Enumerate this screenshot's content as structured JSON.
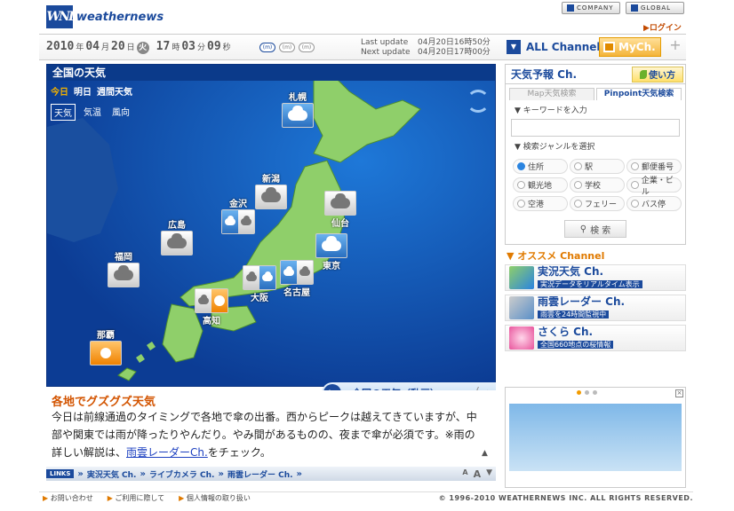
{
  "header": {
    "logo_mark": "WNI",
    "logo_text": "weathernews",
    "company": "COMPANY",
    "global": "GLOBAL",
    "login": "ログイン"
  },
  "datebar": {
    "year": "2010",
    "year_unit": "年",
    "month": "04",
    "month_unit": "月",
    "day": "20",
    "day_unit": "日",
    "dow": "火",
    "hour": "17",
    "hour_unit": "時",
    "minute": "03",
    "minute_unit": "分",
    "second": "09",
    "second_unit": "秒",
    "size_small": "(m)",
    "size_medium": "(m)",
    "size_large": "(m)",
    "last_update_label": "Last update",
    "last_update_value": "04月20日16時50分",
    "next_update_label": "Next update",
    "next_update_value": "04月20日17時00分",
    "all_channel": "ALL Channel",
    "mych": "MyCh.",
    "plus": "+"
  },
  "map": {
    "title": "全国の天気",
    "day_tabs": [
      "今日",
      "明日",
      "週間天気"
    ],
    "type_tabs": [
      "天気",
      "気温",
      "風向"
    ],
    "cities": [
      {
        "name": "札幌",
        "kind": "blue"
      },
      {
        "name": "新潟",
        "kind": "cloud"
      },
      {
        "name": "仙台",
        "kind": "cloud"
      },
      {
        "name": "金沢",
        "kind": "dual-bw"
      },
      {
        "name": "東京",
        "kind": "blue"
      },
      {
        "name": "広島",
        "kind": "cloud"
      },
      {
        "name": "福岡",
        "kind": "cloud"
      },
      {
        "name": "大阪",
        "kind": "dual-wb"
      },
      {
        "name": "名古屋",
        "kind": "dual-bw"
      },
      {
        "name": "高知",
        "kind": "dual-ws"
      },
      {
        "name": "那覇",
        "kind": "sun"
      }
    ],
    "video_label": "全国の天気（動画）",
    "video_sub": "(→"
  },
  "commentary": {
    "title": "各地でグズグズ天気",
    "body_before": "今日は前線通過のタイミングで各地で傘の出番。西からピークは越えてきていますが、中部や関東では雨が降ったりやんだり。やみ間があるものの、夜まで傘が必須です。※雨の詳しい解説は、",
    "body_link": "雨雲レーダーCh.",
    "body_after": "をチェック。",
    "scroll_up": "▲",
    "scroll_down": "▼"
  },
  "links": {
    "tag": "LINKS",
    "items": [
      "実況天気 Ch.",
      "ライブカメラ Ch.",
      "雨雲レーダー Ch."
    ],
    "font_small": "A",
    "font_large": "A"
  },
  "sidebar": {
    "title": "天気予報 Ch.",
    "howto": "使い方",
    "tabs": [
      "Map天気検索",
      "Pinpoint天気検索"
    ],
    "keyword_label": "▼ キーワードを入力",
    "keyword_placeholder": "",
    "genre_label": "▼ 検索ジャンルを選択",
    "genres": [
      "住所",
      "駅",
      "郵便番号",
      "観光地",
      "学校",
      "企業・ビル",
      "空港",
      "フェリー",
      "バス停"
    ],
    "search_button": "検 索",
    "recommend_title": "オススメ Channel",
    "channels": [
      {
        "title": "実況天気 Ch.",
        "desc": "実況データをリアルタイム表示"
      },
      {
        "title": "雨雲レーダー Ch.",
        "desc": "雨雲を24時間監視中"
      },
      {
        "title": "さくら Ch.",
        "desc": "全国660地点の桜情報"
      }
    ]
  },
  "footer": {
    "contact": "お問い合わせ",
    "terms": "ご利用に際して",
    "privacy": "個人情報の取り扱い",
    "copyright": "© 1996-2010 WEATHERNEWS INC. ALL RIGHTS RESERVED."
  },
  "colors": {
    "brand": "#1b4a9c",
    "accent": "#e07a00",
    "map_sea": "#1553b8",
    "map_land": "#8fcf6a"
  }
}
